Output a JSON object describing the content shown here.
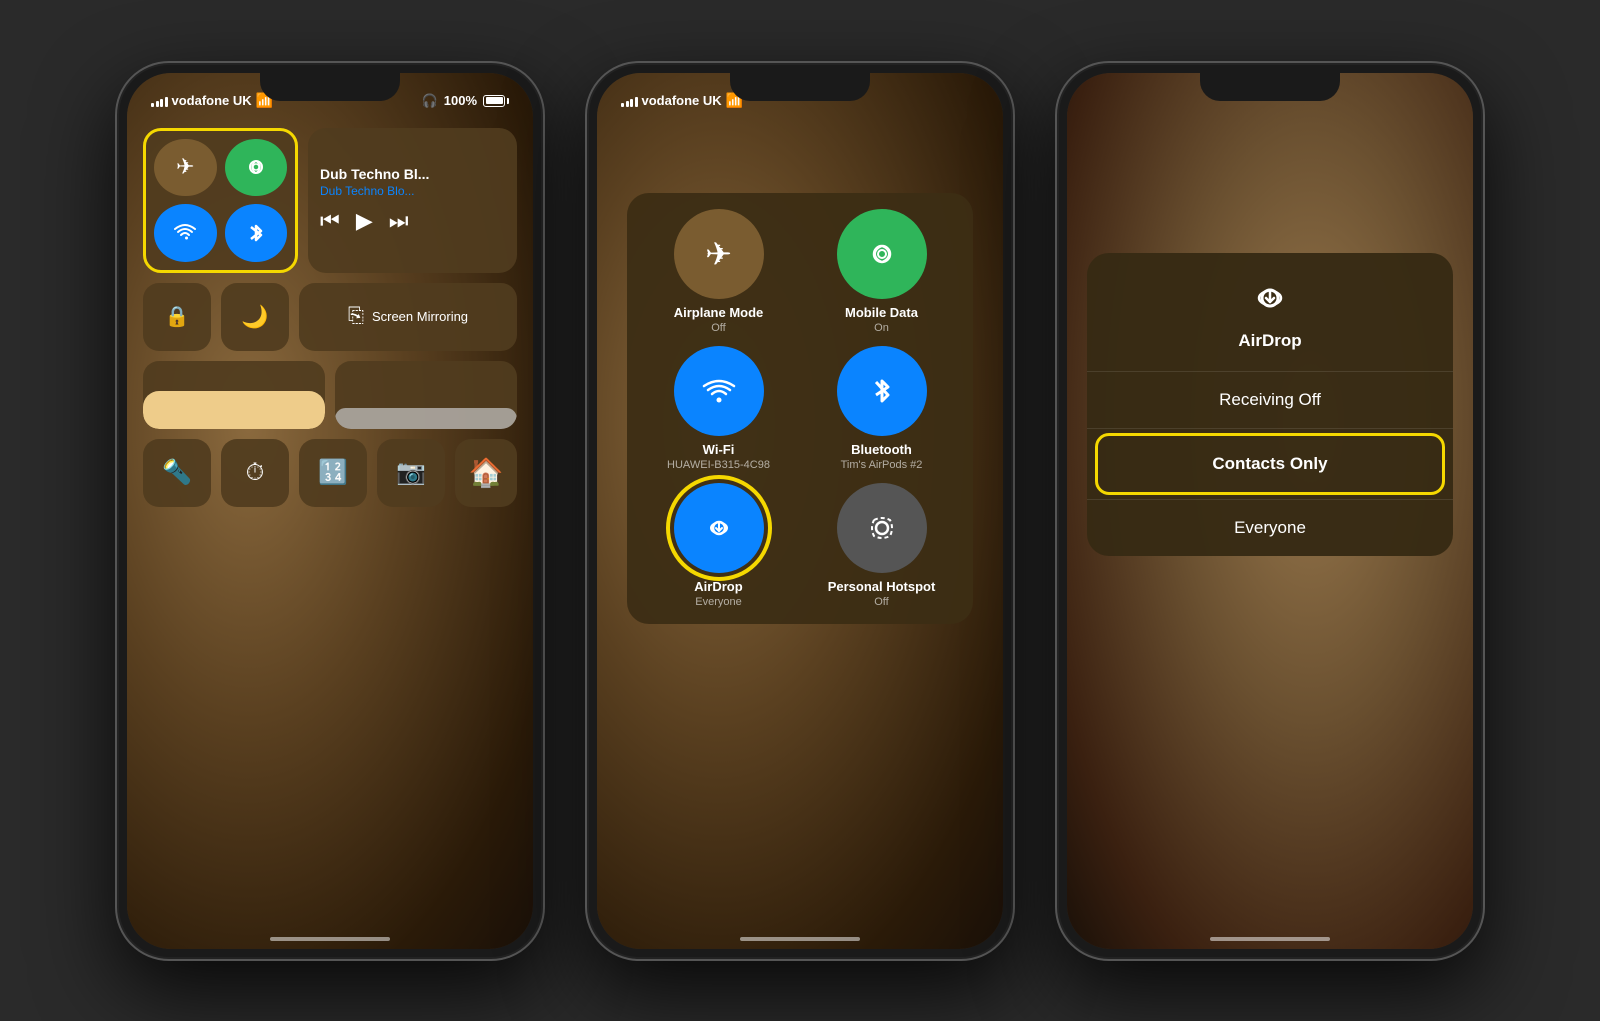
{
  "phones": {
    "phone1": {
      "status": {
        "carrier": "vodafone UK",
        "wifi": true,
        "headphones": true,
        "battery": "100%"
      },
      "control_center": {
        "media": {
          "title": "Dub Techno Bl...",
          "subtitle": "Dub Techno Blo..."
        },
        "screen_mirroring_label": "Screen Mirroring",
        "connectivity_outline_color": "#f5d800"
      }
    },
    "phone2": {
      "status": {
        "carrier": "vodafone UK",
        "wifi": true
      },
      "expanded_cc": {
        "items": [
          {
            "label": "Airplane Mode",
            "sublabel": "Off",
            "color": "brown",
            "icon": "✈"
          },
          {
            "label": "Mobile Data",
            "sublabel": "On",
            "color": "green",
            "icon": "📶"
          },
          {
            "label": "Wi-Fi",
            "sublabel": "HUAWEI-B315-4C98",
            "color": "blue",
            "icon": "wifi"
          },
          {
            "label": "Bluetooth",
            "sublabel": "Tim's AirPods #2",
            "color": "blue",
            "icon": "bluetooth"
          },
          {
            "label": "AirDrop",
            "sublabel": "Everyone",
            "color": "airdrop-blue",
            "icon": "airdrop",
            "highlighted": true
          },
          {
            "label": "Personal Hotspot",
            "sublabel": "Off",
            "color": "gray",
            "icon": "hotspot"
          }
        ]
      }
    },
    "phone3": {
      "airdrop_menu": {
        "title": "AirDrop",
        "options": [
          {
            "label": "Receiving Off",
            "highlighted": false
          },
          {
            "label": "Contacts Only",
            "highlighted": true
          },
          {
            "label": "Everyone",
            "highlighted": false
          }
        ]
      }
    }
  }
}
